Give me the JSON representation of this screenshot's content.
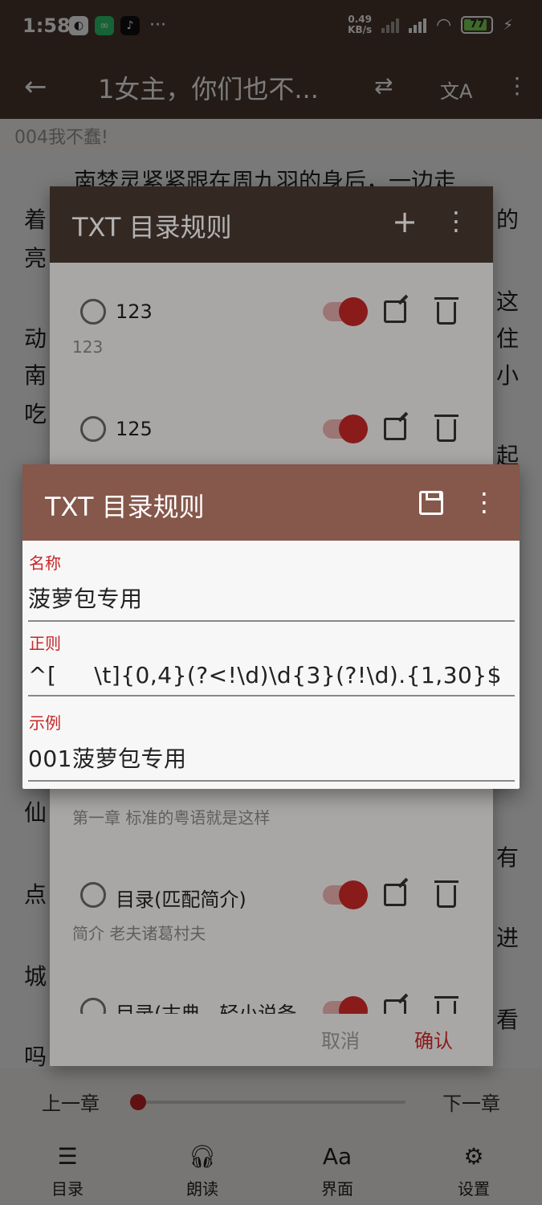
{
  "status": {
    "time": "1:58",
    "net_speed_top": "0.49",
    "net_speed_bottom": "KB/s",
    "battery": "77",
    "hd": "HD"
  },
  "topbar": {
    "back": "←",
    "title": "1女主，你们也不...",
    "shuffle": "⇄",
    "translate": "文A",
    "more": "⋮"
  },
  "chapter": "004我不蠢!",
  "reader": {
    "line1": "南梦灵紧紧跟在周九羽的身后，一边走",
    "right_chars": [
      "的",
      "这",
      "住",
      "小",
      "起",
      "有",
      "进",
      "看"
    ],
    "left_chars": [
      "着",
      "亮",
      "动",
      "南",
      "吃",
      "仙",
      "点",
      "城",
      "吗"
    ]
  },
  "rule_list": {
    "title": "TXT 目录规则",
    "add": "+",
    "more": "⋮",
    "rules": [
      {
        "name": "123",
        "example": "123"
      },
      {
        "name": "125",
        "example": ""
      },
      {
        "name": "",
        "example": "第一章 标准的粤语就是这样"
      },
      {
        "name": "目录(匹配简介)",
        "example": "简介 老夫诸葛村夫"
      },
      {
        "name": "目录(古典、轻小说备",
        "example": ""
      }
    ],
    "cancel": "取消",
    "confirm": "确认"
  },
  "edit_dialog": {
    "title": "TXT 目录规则",
    "more": "⋮",
    "name_label": "名称",
    "name_value": "菠萝包专用",
    "regex_label": "正则",
    "regex_value": "^[     \\t]{0,4}(?<!\\d)\\d{3}(?!\\d).{1,30}$",
    "example_label": "示例",
    "example_value": "001菠萝包专用"
  },
  "bottom": {
    "prev": "上一章",
    "next": "下一章",
    "progress": 0,
    "nav": [
      {
        "label": "目录",
        "icon": "list-icon"
      },
      {
        "label": "朗读",
        "icon": "headphones-icon"
      },
      {
        "label": "界面",
        "icon": "font-icon"
      },
      {
        "label": "设置",
        "icon": "gear-icon"
      }
    ]
  },
  "colors": {
    "appbar": "#4b3a31",
    "dialog_header": "#86574b",
    "accent": "#c62828"
  }
}
